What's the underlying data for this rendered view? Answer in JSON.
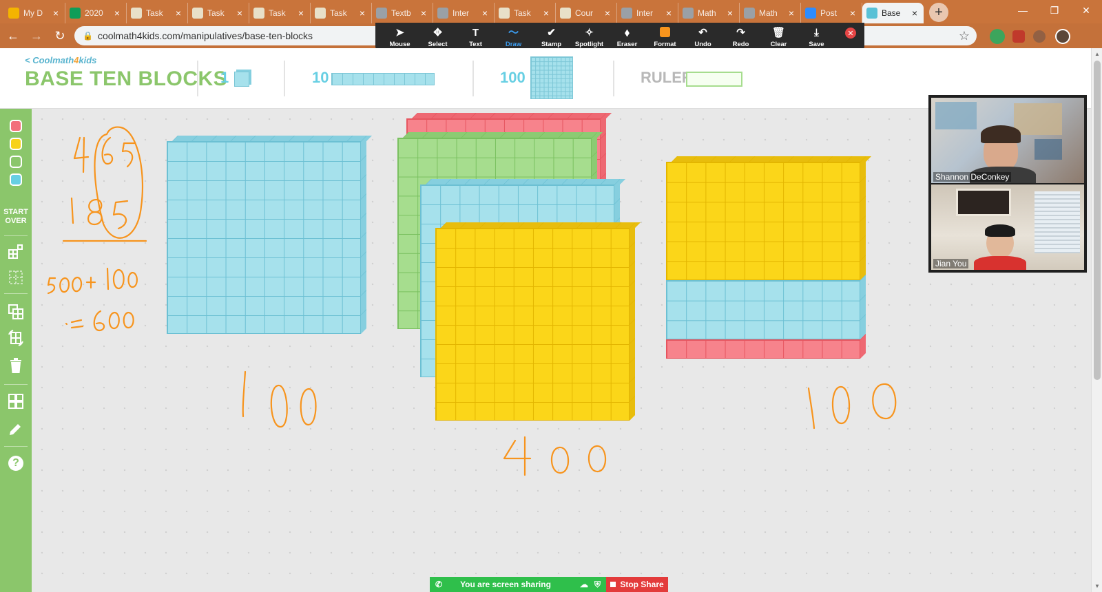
{
  "browser": {
    "tabs": [
      {
        "label": "My D",
        "icon": "drive-icon",
        "color": "#f4b400"
      },
      {
        "label": "2020",
        "icon": "sheets-icon",
        "color": "#0f9d58"
      },
      {
        "label": "Task",
        "icon": "doc-icon",
        "color": "#e8e0c8"
      },
      {
        "label": "Task",
        "icon": "doc-icon",
        "color": "#e8e0c8"
      },
      {
        "label": "Task",
        "icon": "doc-icon",
        "color": "#e8e0c8"
      },
      {
        "label": "Task",
        "icon": "doc-icon",
        "color": "#e8e0c8"
      },
      {
        "label": "Textb",
        "icon": "globe-icon",
        "color": "#9aa0a6"
      },
      {
        "label": "Inter",
        "icon": "globe-icon",
        "color": "#9aa0a6"
      },
      {
        "label": "Task",
        "icon": "doc-icon",
        "color": "#e8e0c8"
      },
      {
        "label": "Cour",
        "icon": "doc-icon",
        "color": "#e8e0c8"
      },
      {
        "label": "Inter",
        "icon": "globe-icon",
        "color": "#9aa0a6"
      },
      {
        "label": "Math",
        "icon": "globe-icon",
        "color": "#9aa0a6"
      },
      {
        "label": "Math",
        "icon": "globe-icon",
        "color": "#9aa0a6"
      },
      {
        "label": "Post",
        "icon": "zoom-icon",
        "color": "#2d8cff"
      },
      {
        "label": "Base",
        "icon": "coolmath-icon",
        "color": "#59c1d6",
        "active": true
      }
    ],
    "url": "coolmath4kids.com/manipulatives/base-ten-blocks"
  },
  "zoom_toolbar": {
    "tools": [
      {
        "label": "Mouse",
        "icon": "cursor-icon",
        "glyph": "➤"
      },
      {
        "label": "Select",
        "icon": "move-icon",
        "glyph": "✥"
      },
      {
        "label": "Text",
        "icon": "text-icon",
        "glyph": "T"
      },
      {
        "label": "Draw",
        "icon": "draw-icon",
        "glyph": "〜",
        "selected": true
      },
      {
        "label": "Stamp",
        "icon": "stamp-icon",
        "glyph": "✔"
      },
      {
        "label": "Spotlight",
        "icon": "spotlight-icon",
        "glyph": "✧"
      },
      {
        "label": "Eraser",
        "icon": "eraser-icon",
        "glyph": "⬧"
      },
      {
        "label": "Format",
        "icon": "format-icon",
        "glyph": "■"
      },
      {
        "label": "Undo",
        "icon": "undo-icon",
        "glyph": "↶"
      },
      {
        "label": "Redo",
        "icon": "redo-icon",
        "glyph": "↷"
      },
      {
        "label": "Clear",
        "icon": "trash-icon",
        "glyph": "🗑"
      },
      {
        "label": "Save",
        "icon": "save-icon",
        "glyph": "⤓"
      }
    ],
    "format_color": "#f7941d"
  },
  "app": {
    "logo_small": "Coolmath4kids",
    "logo_small_prefix": "< Coolmath",
    "logo_small_four": "4",
    "logo_small_suffix": "kids",
    "title": "BASE TEN BLOCKS",
    "palette": [
      {
        "label": "1",
        "kind": "unit"
      },
      {
        "label": "10",
        "kind": "rod"
      },
      {
        "label": "100",
        "kind": "flat"
      },
      {
        "label": "RULER",
        "kind": "ruler"
      }
    ],
    "sidebar": {
      "colors": [
        "#f2707b",
        "#f7d21a",
        "#8bc66b",
        "#67cfe3"
      ],
      "start_over": [
        "START",
        "OVER"
      ]
    }
  },
  "annotations": {
    "addend_1": "465",
    "addend_2": "185",
    "sum_line": "500+ 100",
    "result": "= 600",
    "label_left": "100",
    "label_middle": "400",
    "label_right": "100",
    "ink_color": "#f7941d"
  },
  "video": {
    "participants": [
      {
        "name": "Shannon DeConkey"
      },
      {
        "name": "Jian You"
      }
    ]
  },
  "share_bar": {
    "status": "You are screen sharing",
    "stop_label": "Stop Share"
  },
  "blocks": {
    "colors": {
      "blue": {
        "face": "#a6e1ec",
        "line": "#6cc0d3",
        "dark": "#86cfdf"
      },
      "green": {
        "face": "#a6dd8e",
        "line": "#79c05f",
        "dark": "#8ccb73"
      },
      "red": {
        "face": "#f7838c",
        "line": "#e6555f",
        "dark": "#ee6872"
      },
      "yellow": {
        "face": "#fbd619",
        "line": "#e3b500",
        "dark": "#e8bd0c"
      }
    }
  }
}
